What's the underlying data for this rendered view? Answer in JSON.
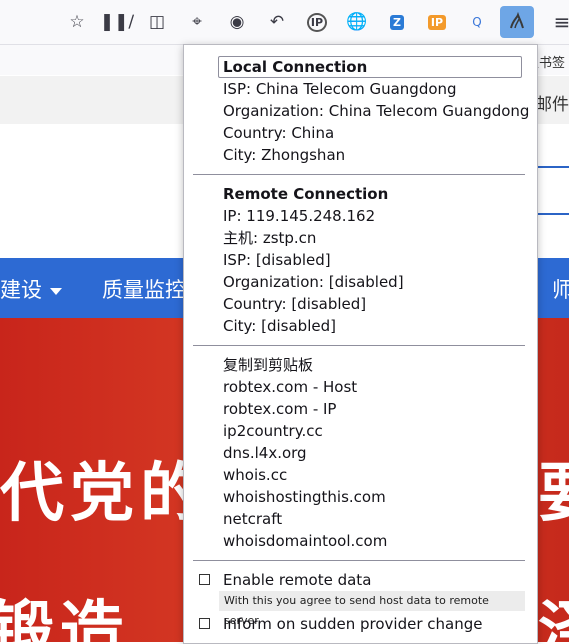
{
  "toolbar": {
    "icons": [
      "bookmark-star-icon",
      "library-icon",
      "sidebar-icon",
      "crop-icon",
      "chat-icon",
      "undo-icon",
      "ip-lookup-icon",
      "globe-icon",
      "zotero-icon",
      "ip-badge-icon",
      "query-icon",
      "flagfox-icon",
      "menu-icon"
    ],
    "ip_badge": "IP",
    "ip_lookup": "IP",
    "query": "Q",
    "zotero": "Z"
  },
  "bookmarks": {
    "folder_label": "板书签"
  },
  "page": {
    "mail_link": "邮件",
    "nav_items": [
      "建设",
      "质量监控",
      "师"
    ],
    "banner_line1": "代党的",
    "banner_line1_right": "要",
    "banner_line2": "锻造",
    "banner_line2_right": "泽"
  },
  "popup": {
    "local": {
      "heading": "Local Connection",
      "isp": "ISP: China Telecom Guangdong",
      "organization": "Organization: China Telecom Guangdong",
      "country": "Country: China",
      "city": "City: Zhongshan"
    },
    "remote": {
      "heading": "Remote Connection",
      "ip": "IP: 119.145.248.162",
      "host": "主机: zstp.cn",
      "isp": "ISP: [disabled]",
      "organization": "Organization: [disabled]",
      "country": "Country: [disabled]",
      "city": "City: [disabled]"
    },
    "links": [
      "复制到剪贴板",
      "robtex.com - Host",
      "robtex.com - IP",
      "ip2country.cc",
      "dns.l4x.org",
      "whois.cc",
      "whoishostingthis.com",
      "netcraft",
      "whoisdomaintool.com"
    ],
    "options": {
      "enable_remote": "Enable remote data",
      "enable_remote_note": "With this you agree to send host data to remote server.",
      "inform_change": "Inform on sudden provider change"
    }
  },
  "colors": {
    "nav_blue": "#2d6ad3",
    "banner_red": "#c8251b",
    "active_icon_bg": "#6ea6e6"
  }
}
